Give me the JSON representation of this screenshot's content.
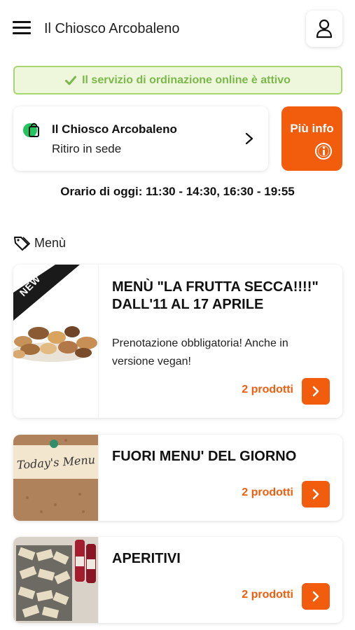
{
  "header": {
    "title": "Il Chiosco Arcobaleno",
    "menu_icon": "hamburger-icon",
    "profile_icon": "user-icon"
  },
  "status": {
    "text": "Il servizio di ordinazione online è attivo",
    "icon": "check-icon",
    "color": "#7ab84a"
  },
  "store": {
    "name": "Il Chiosco Arcobaleno",
    "mode": "Ritiro in sede",
    "icon": "shopping-bag-icon",
    "status_color": "#22c55e"
  },
  "info_button": {
    "label": "Più info",
    "icon": "info-icon"
  },
  "hours": "Orario di oggi: 11:30 - 14:30, 16:30 - 19:55",
  "section": {
    "label": "Menù",
    "icon": "tag-icon"
  },
  "categories": [
    {
      "title": "MENÙ \"LA FRUTTA SECCA!!!!\" DALL'11 AL 17 APRILE",
      "description": "Prenotazione obbligatoria! Anche in versione vegan!",
      "count": "2 prodotti",
      "ribbon": "NEW"
    },
    {
      "title": "FUORI MENU' DEL GIORNO",
      "count": "2 prodotti",
      "image_text": "Today's Menu"
    },
    {
      "title": "APERITIVI",
      "count": "2 prodotti"
    }
  ],
  "accent_color": "#f25d0d"
}
